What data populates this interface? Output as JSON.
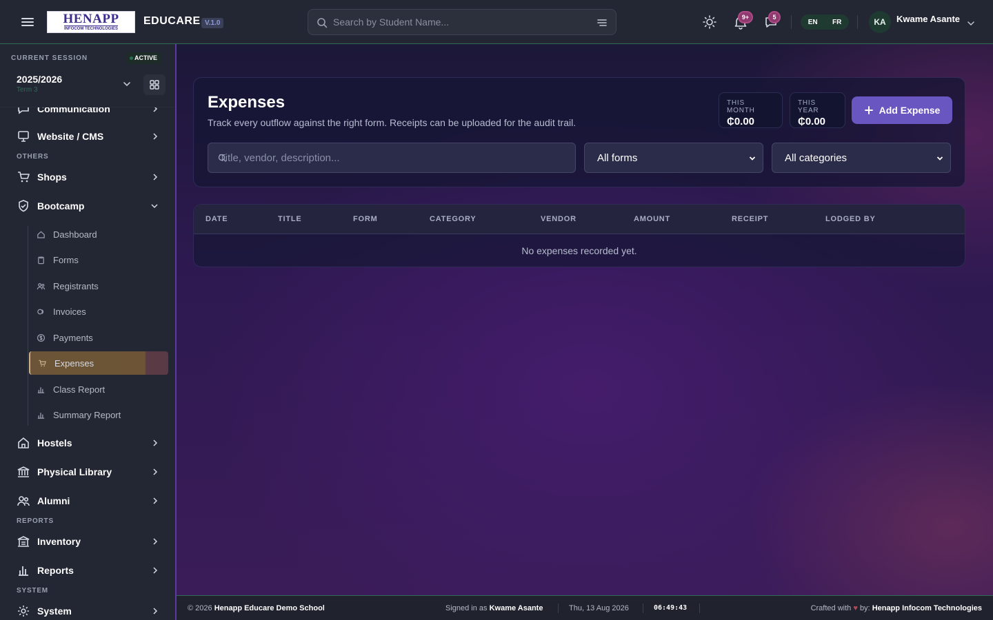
{
  "app": {
    "logo_main": "HENAPP",
    "logo_sub": "INFOCOM TECHNOLOGIES",
    "name": "EDUCARE",
    "version": "V.1.0"
  },
  "search": {
    "placeholder": "Search by Student Name..."
  },
  "notifications": {
    "alerts_count": "9+",
    "messages_count": "5"
  },
  "language": {
    "options": [
      "EN",
      "FR"
    ],
    "selected": "EN"
  },
  "user": {
    "initials": "KA",
    "name": "Kwame Asante"
  },
  "session": {
    "label": "CURRENT SESSION",
    "status": "ACTIVE",
    "year": "2025/2026",
    "term": "Term 3"
  },
  "sidebar": {
    "partial_item": "Communication",
    "website": "Website / CMS",
    "section_others": "OTHERS",
    "shops": "Shops",
    "bootcamp": "Bootcamp",
    "bootcamp_items": [
      "Dashboard",
      "Forms",
      "Registrants",
      "Invoices",
      "Payments",
      "Expenses",
      "Class Report",
      "Summary Report"
    ],
    "active_item": "Expenses",
    "hostels": "Hostels",
    "library": "Physical Library",
    "alumni": "Alumni",
    "section_reports": "REPORTS",
    "inventory": "Inventory",
    "reports": "Reports",
    "section_system": "SYSTEM",
    "system": "System"
  },
  "page": {
    "title": "Expenses",
    "subtitle": "Track every outflow against the right form. Receipts can be uploaded for the audit trail.",
    "stats": {
      "month_label": "THIS MONTH",
      "month_value": "₵0.00",
      "year_label": "THIS YEAR",
      "year_value": "₵0.00"
    },
    "add_button": "Add Expense",
    "filter_placeholder": "Title, vendor, description...",
    "form_filter": "All forms",
    "category_filter": "All categories"
  },
  "table": {
    "columns": [
      "DATE",
      "TITLE",
      "FORM",
      "CATEGORY",
      "VENDOR",
      "AMOUNT",
      "RECEIPT",
      "LODGED BY"
    ],
    "empty_message": "No expenses recorded yet."
  },
  "footer": {
    "copyright_prefix": "© 2026",
    "school": "Henapp Educare Demo School",
    "signed_prefix": "Signed in as",
    "signed_user": "Kwame Asante",
    "date": "Thu, 13 Aug 2026",
    "time": "06:49:43",
    "crafted_prefix": "Crafted with",
    "crafted_by": "by:",
    "company": "Henapp Infocom Technologies"
  },
  "colors": {
    "accent_green": "#2f6b55",
    "accent_purple": "#6a56c0",
    "active_item": "#6b5437"
  }
}
